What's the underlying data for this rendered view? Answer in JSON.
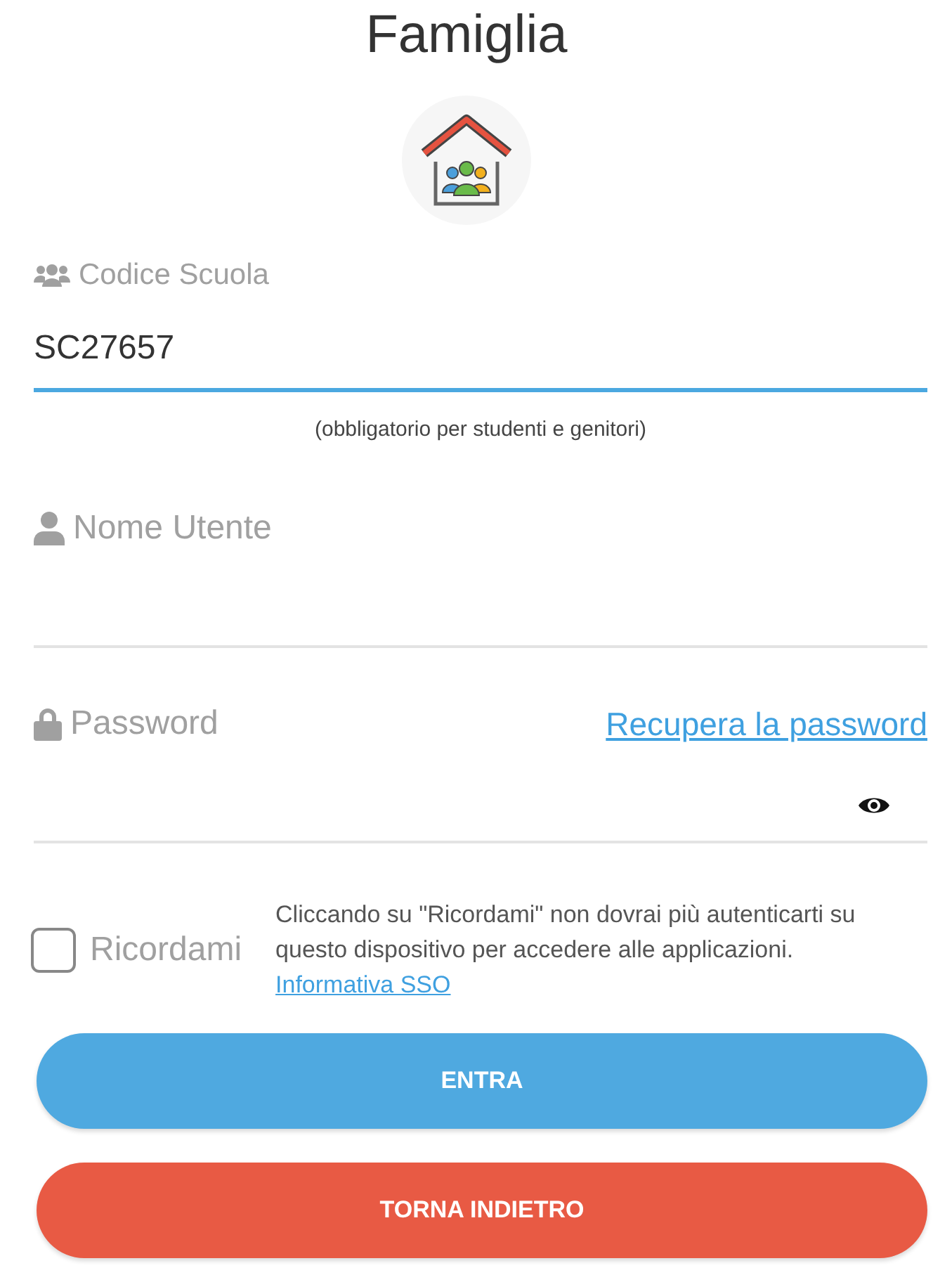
{
  "title": "Famiglia",
  "fields": [
    {
      "kind": "school",
      "label": "Codice Scuola",
      "value": "SC27657",
      "focused": true,
      "hint": "(obbligatorio per studenti e genitori)"
    },
    {
      "kind": "user",
      "label": "Nome Utente",
      "focused": false
    },
    {
      "kind": "password",
      "label": "Password",
      "focused": false,
      "link": "Recupera la password"
    }
  ],
  "remember": {
    "label": "Ricordami",
    "checked": false,
    "note": "Cliccando su \"Ricordami\" non dovrai più autenticarti su questo dispositivo per accedere alle applicazioni.",
    "link": "Informativa SSO"
  },
  "buttons": [
    {
      "kind": "primary",
      "label": "ENTRA"
    },
    {
      "kind": "secondary",
      "label": "TORNA INDIETRO"
    }
  ]
}
